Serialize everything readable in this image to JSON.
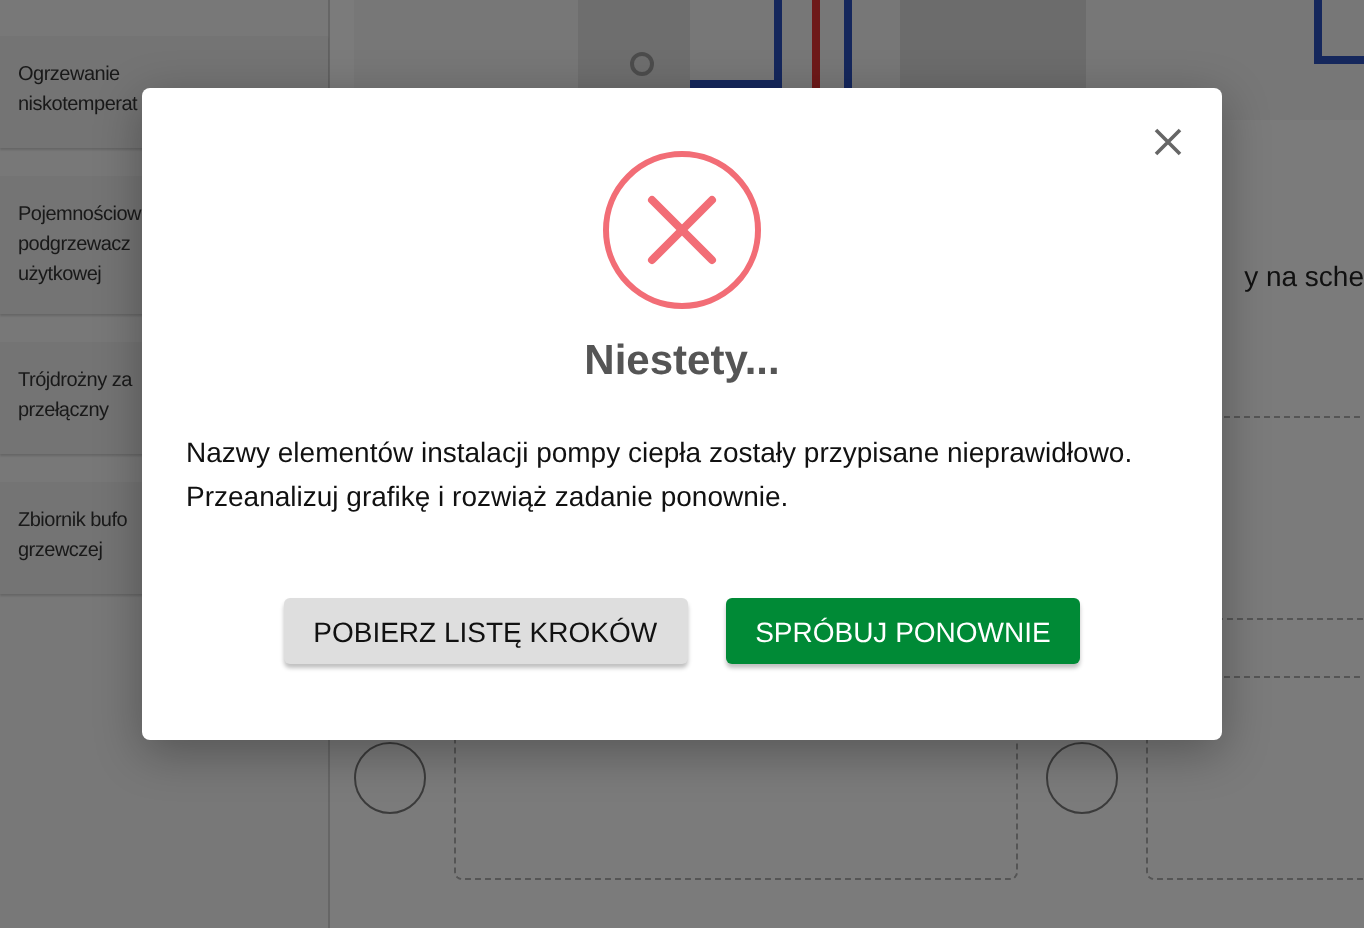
{
  "sidebar": {
    "items": [
      {
        "lines": [
          "Ogrzewanie",
          "niskotemperat"
        ]
      },
      {
        "lines": [
          "Pojemnościow",
          "podgrzewacz",
          "użytkowej"
        ]
      },
      {
        "lines": [
          "Trójdrożny za",
          "przełączny"
        ]
      },
      {
        "lines": [
          "Zbiornik bufo",
          "grzewczej"
        ]
      }
    ]
  },
  "main": {
    "instruction": "y na sche"
  },
  "dialog": {
    "open": true,
    "title": "Niestety...",
    "message": [
      "Nazwy elementów instalacji pompy ciepła zostały przypisane nieprawidłowo.",
      "Przeanalizuj grafikę i rozwiąż zadanie ponownie."
    ],
    "buttons": [
      {
        "label": "POBIERZ LISTĘ KROKÓW",
        "kind": "secondary"
      },
      {
        "label": "SPRÓBUJ PONOWNIE",
        "kind": "primary"
      }
    ]
  }
}
